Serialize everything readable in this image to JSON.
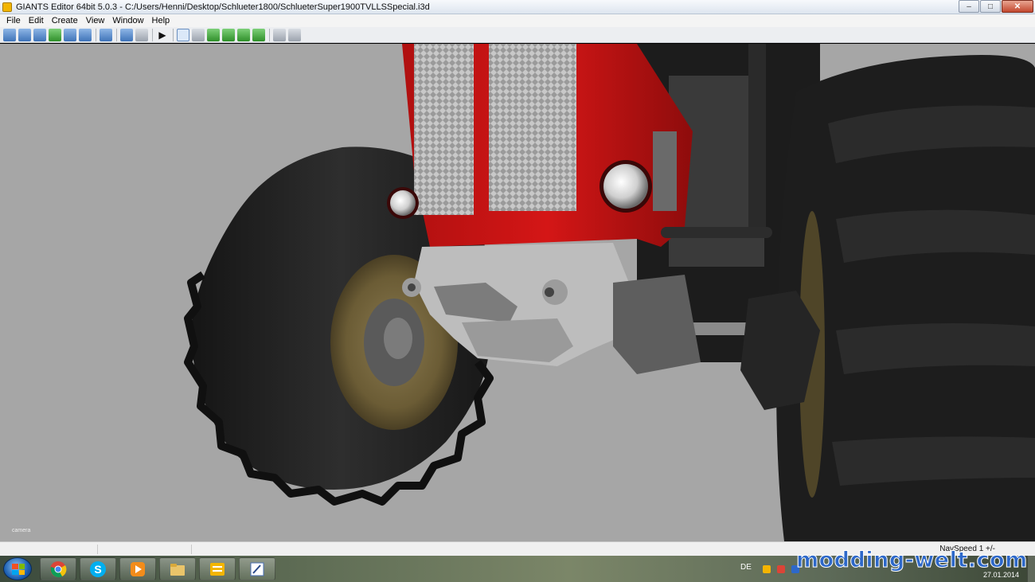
{
  "window": {
    "title": "GIANTS Editor 64bit 5.0.3 - C:/Users/Henni/Desktop/Schlueter1800/SchlueterSuper1900TVLLSSpecial.i3d",
    "buttons": {
      "minimize": "‒",
      "maximize": "□",
      "close": "✕"
    }
  },
  "menu": {
    "items": [
      "File",
      "Edit",
      "Create",
      "View",
      "Window",
      "Help"
    ]
  },
  "toolbar": {
    "icons": [
      "new-icon",
      "open-icon",
      "import-icon",
      "refresh-icon",
      "save-icon",
      "save-all-icon",
      "scene-graph-icon",
      "undo-icon",
      "redo-icon",
      "play-icon",
      "select-icon",
      "magnet-icon",
      "terrain-sculpt-icon",
      "terrain-paint-icon",
      "foliage-paint-icon",
      "grass-paint-icon",
      "settings-icon",
      "network-icon"
    ],
    "play_glyph": "▶"
  },
  "viewport": {
    "camera_label": "camera",
    "background": "#a6a6a6"
  },
  "statusbar": {
    "nav_speed": "NavSpeed 1 +/-"
  },
  "taskbar": {
    "apps": [
      "chrome-icon",
      "skype-icon",
      "media-player-icon",
      "file-explorer-icon",
      "giants-editor-icon",
      "paint-icon"
    ],
    "language": "DE",
    "date": "27.01.2014"
  },
  "watermark": "modding-welt.com"
}
